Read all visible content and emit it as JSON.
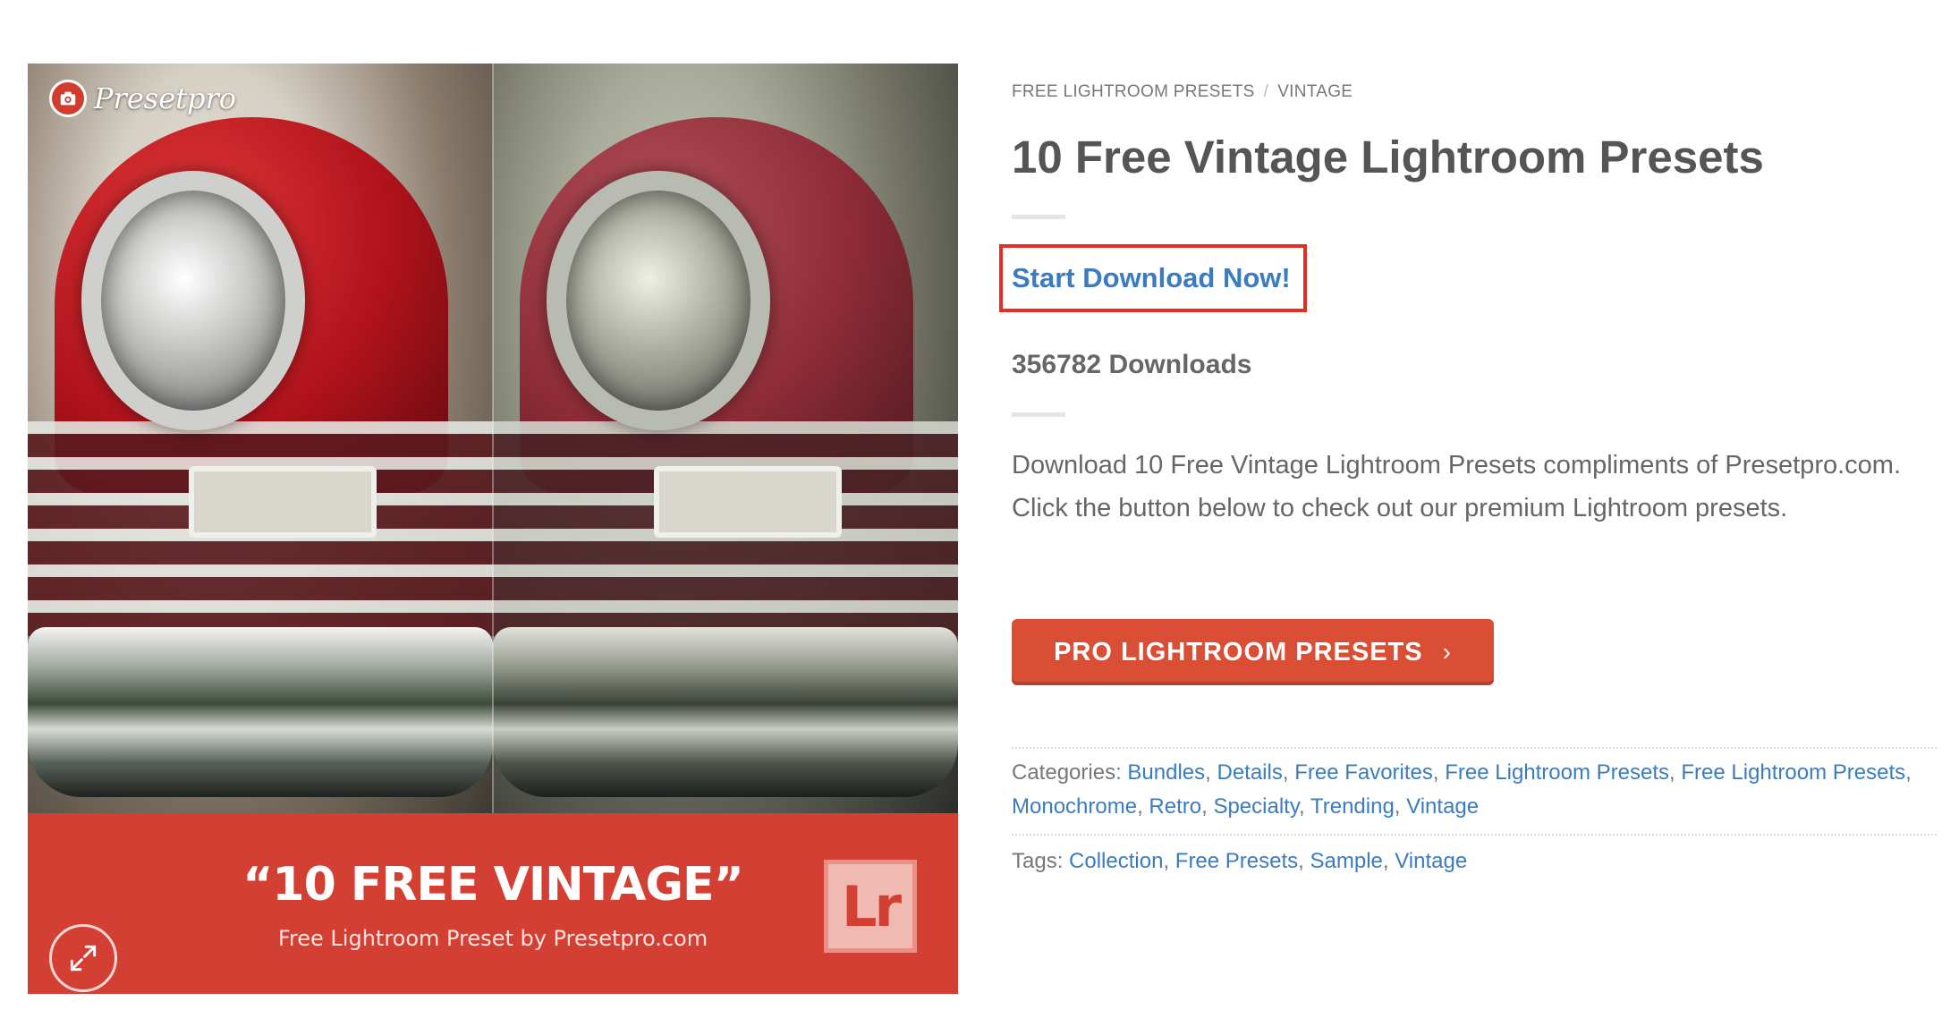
{
  "image": {
    "logo_text": "Presetpro",
    "banner_title": "“10 FREE VINTAGE”",
    "banner_subtitle": "Free Lightroom Preset by Presetpro.com",
    "lr_logo_text": "Lr"
  },
  "breadcrumb": {
    "items": [
      "FREE LIGHTROOM PRESETS",
      "VINTAGE"
    ],
    "separator": "/"
  },
  "product": {
    "title": "10 Free Vintage Lightroom Presets",
    "download_link": "Start Download Now!",
    "download_count": "356782 Downloads",
    "description": "Download 10 Free Vintage Lightroom Presets compliments of Presetpro.com. Click the button below to check out our premium Lightroom presets.",
    "button_label": "PRO LIGHTROOM PRESETS",
    "button_chevron": "›"
  },
  "meta": {
    "categories_label": "Categories:",
    "categories": [
      "Bundles",
      "Details",
      "Free Favorites",
      "Free Lightroom Presets",
      "Free Lightroom Presets",
      "Monochrome",
      "Retro",
      "Specialty",
      "Trending",
      "Vintage"
    ],
    "tags_label": "Tags:",
    "tags": [
      "Collection",
      "Free Presets",
      "Sample",
      "Vintage"
    ]
  },
  "colors": {
    "accent_red": "#d43f33",
    "button_red": "#d94e35",
    "link_blue": "#3b7bbf",
    "highlight_box": "#e03025"
  }
}
